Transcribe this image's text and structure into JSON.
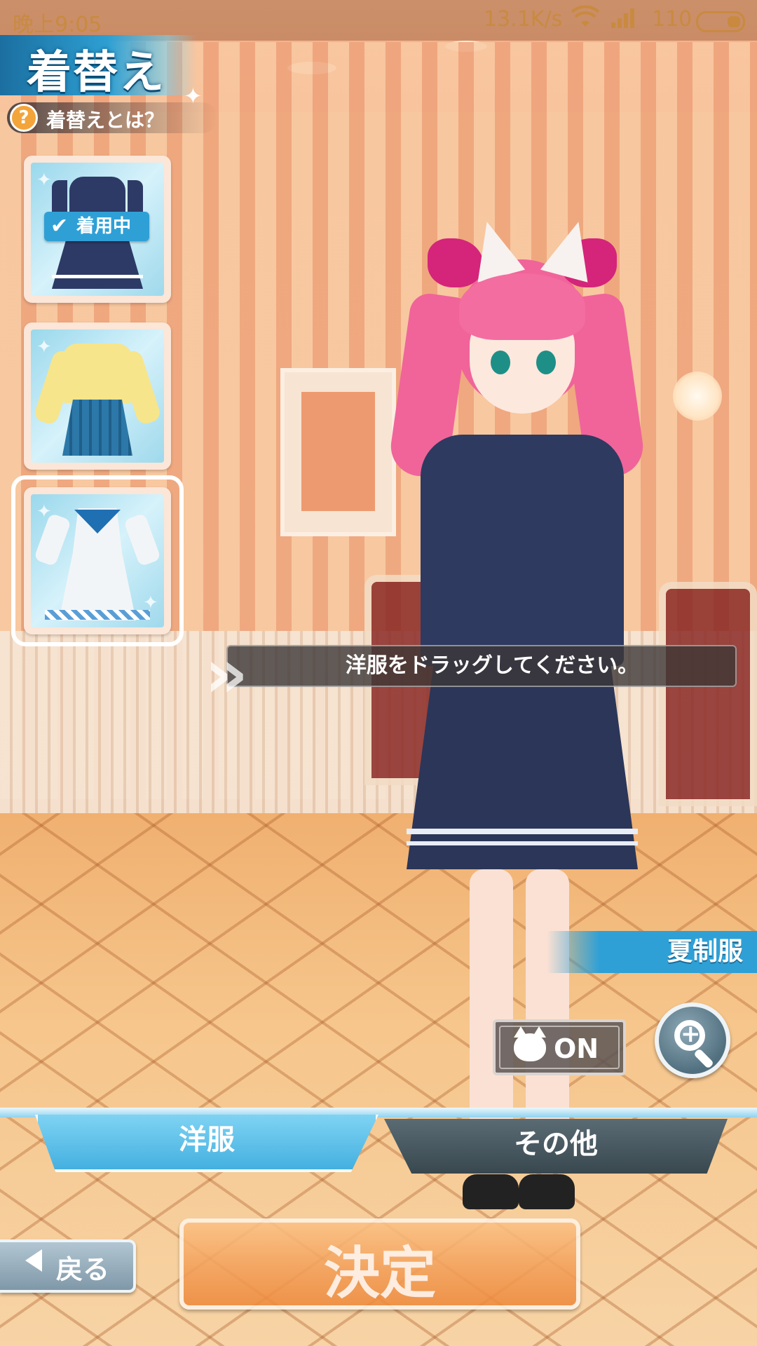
{
  "status_bar": {
    "time": "晚上9:05",
    "net_speed": "13.1K/s",
    "wifi_icon": "wifi-icon",
    "signal_icon": "signal-icon",
    "battery_text": "110"
  },
  "header": {
    "title": "着替え",
    "help_icon": "question-icon",
    "help_label": "着替えとは？"
  },
  "outfits": {
    "items": [
      {
        "name": "winter-uniform",
        "badge": "着用中",
        "equipped": true
      },
      {
        "name": "yellow-sweater-outfit",
        "equipped": false
      },
      {
        "name": "white-sailor-dress",
        "equipped": false,
        "selected": true
      }
    ]
  },
  "hint": {
    "drag_message": "洋服をドラッグしてください。"
  },
  "preview": {
    "outfit_name": "夏制服",
    "cat_toggle_label": "ON",
    "cat_icon": "cat-icon",
    "zoom_icon": "zoom-in-icon"
  },
  "tabs": {
    "clothes": "洋服",
    "other": "その他",
    "active": "洋服"
  },
  "footer": {
    "back_label": "戻る",
    "confirm_label": "決定"
  },
  "colors": {
    "accent_blue": "#2fa0d6",
    "confirm_orange": "#f3a05a",
    "tab_inactive": "#39484f"
  }
}
